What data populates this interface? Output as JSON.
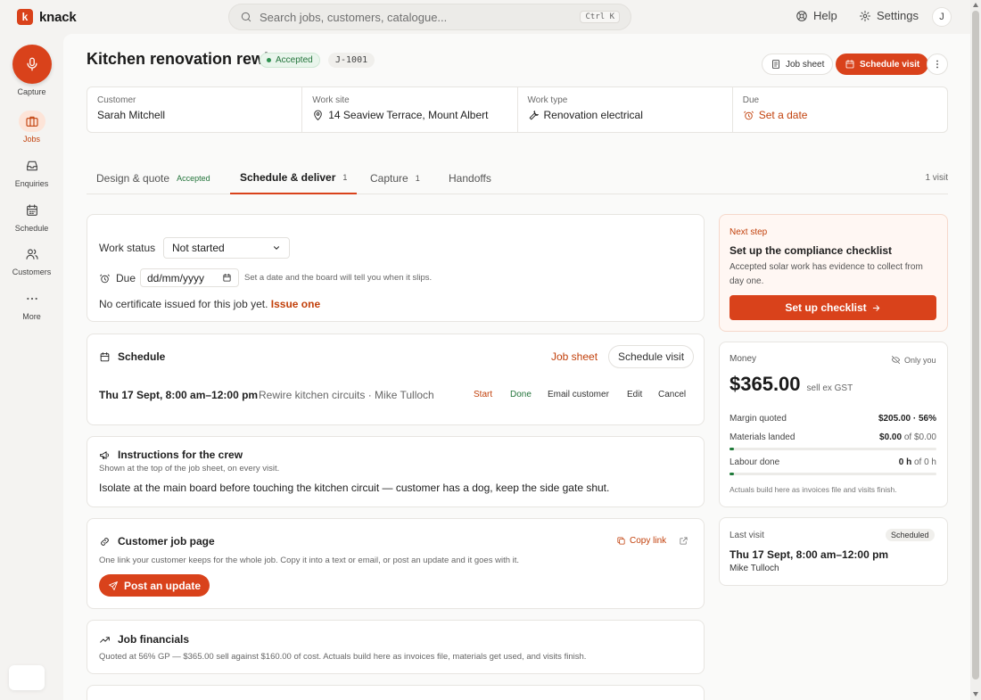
{
  "app": {
    "brand": "knack",
    "brand_letter": "k"
  },
  "search": {
    "placeholder": "Search jobs, customers, catalogue...",
    "shortcut": "Ctrl K"
  },
  "topnav": {
    "help": "Help",
    "settings": "Settings",
    "avatar": "J"
  },
  "sidenav": {
    "capture": "Capture",
    "items": [
      {
        "label": "Jobs",
        "icon": "briefcase-icon",
        "active": true
      },
      {
        "label": "Enquiries",
        "icon": "inbox-icon"
      },
      {
        "label": "Schedule",
        "icon": "calendar-icon"
      },
      {
        "label": "Customers",
        "icon": "users-icon"
      },
      {
        "label": "More",
        "icon": "dots-icon"
      }
    ]
  },
  "job": {
    "title": "Kitchen renovation rewire",
    "status": "Accepted",
    "id": "J-1001",
    "job_sheet": "Job sheet",
    "schedule_visit": "Schedule visit"
  },
  "info": {
    "customer_label": "Customer",
    "customer": "Sarah Mitchell",
    "site_label": "Work site",
    "site": "14 Seaview Terrace, Mount Albert",
    "type_label": "Work type",
    "type": "Renovation electrical",
    "due_label": "Due",
    "due": "Set a date"
  },
  "tabs": [
    {
      "label": "Design & quote",
      "tag": "Accepted"
    },
    {
      "label": "Schedule & deliver",
      "count": "1",
      "active": true
    },
    {
      "label": "Capture",
      "count": "1"
    },
    {
      "label": "Handoffs"
    }
  ],
  "visit_count": "1 visit",
  "work": {
    "status_label": "Work status",
    "status_value": "Not started",
    "due_label": "Due",
    "date_placeholder": "dd/mm/yyyy",
    "due_hint": "Set a date and the board will tell you when it slips.",
    "certificate_text": "No certificate issued for this job yet.",
    "certificate_link": "Issue one"
  },
  "schedule": {
    "title": "Schedule",
    "job_sheet": "Job sheet",
    "schedule_visit": "Schedule visit",
    "visit_time": "Thu 17 Sept, 8:00 am–12:00 pm",
    "visit_desc": "Rewire kitchen circuits · Mike Tulloch",
    "actions": {
      "start": "Start",
      "done": "Done",
      "email": "Email customer",
      "edit": "Edit",
      "cancel": "Cancel"
    }
  },
  "instructions": {
    "title": "Instructions for the crew",
    "sub": "Shown at the top of the job sheet, on every visit.",
    "body": "Isolate at the main board before touching the kitchen circuit — customer has a dog, keep the side gate shut."
  },
  "customer_page": {
    "title": "Customer job page",
    "copy_link": "Copy link",
    "sub": "One link your customer keeps for the whole job. Copy it into a text or email, or post an update and it goes with it.",
    "post_update": "Post an update"
  },
  "financials": {
    "title": "Job financials",
    "sub": "Quoted at 56% GP — $365.00 sell against $160.00 of cost. Actuals build here as invoices file, materials get used, and visits finish."
  },
  "next_step": {
    "eyebrow": "Next step",
    "title": "Set up the compliance checklist",
    "body": "Accepted solar work has evidence to collect from day one.",
    "button": "Set up checklist"
  },
  "money": {
    "label": "Money",
    "visibility": "Only you",
    "amount": "$365.00",
    "amount_note": "sell ex GST",
    "rows": [
      {
        "label": "Margin quoted",
        "value": "$205.00 · 56%"
      },
      {
        "label": "Materials landed",
        "value": "$0.00",
        "of": "of $0.00",
        "progress": 0.02
      },
      {
        "label": "Labour done",
        "value": "0 h",
        "of": "of 0 h",
        "progress": 0.02
      }
    ],
    "foot": "Actuals build here as invoices file and visits finish."
  },
  "last_visit": {
    "label": "Last visit",
    "status": "Scheduled",
    "time": "Thu 17 Sept, 8:00 am–12:00 pm",
    "who": "Mike Tulloch"
  }
}
